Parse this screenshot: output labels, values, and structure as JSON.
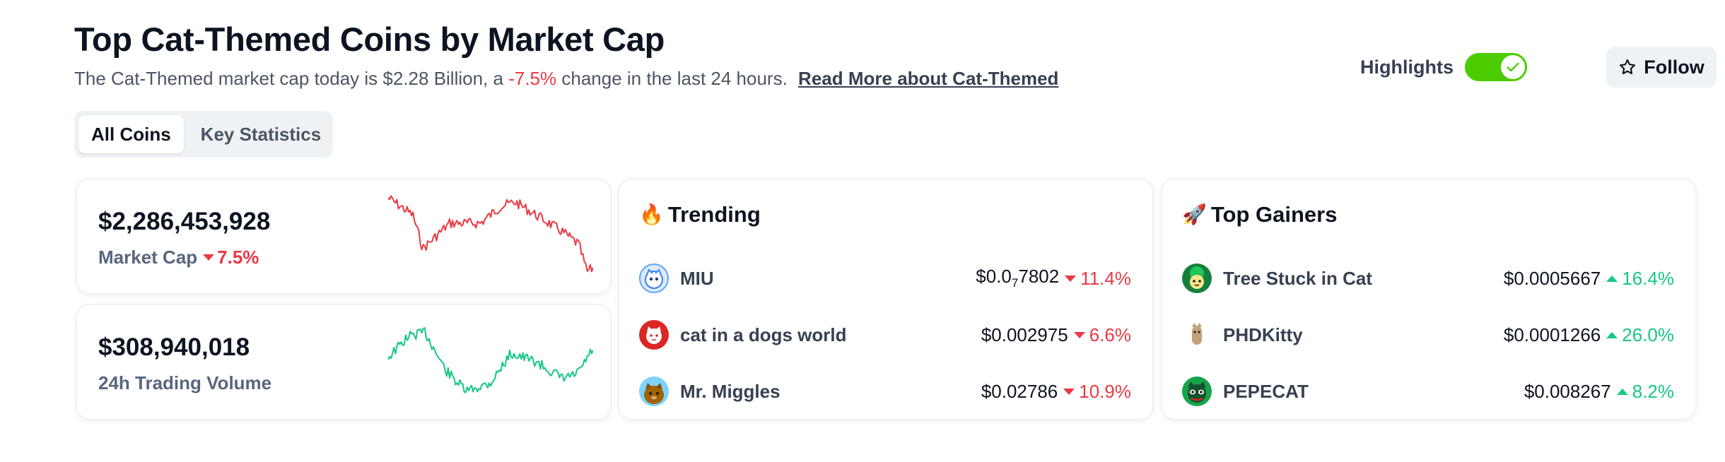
{
  "header": {
    "title": "Top Cat-Themed Coins by Market Cap",
    "subtitle_prefix": "The Cat-Themed market cap today is $2.28 Billion, a",
    "subtitle_change": "-7.5%",
    "subtitle_suffix": "change in the last 24 hours.",
    "read_more": "Read More about Cat-Themed"
  },
  "controls": {
    "highlights_label": "Highlights",
    "highlights_on": true,
    "follow_label": "Follow"
  },
  "tabs": [
    {
      "label": "All Coins",
      "active": true
    },
    {
      "label": "Key Statistics",
      "active": false
    }
  ],
  "market_cap": {
    "value": "$2,286,453,928",
    "label": "Market Cap",
    "change": "7.5%",
    "direction": "down",
    "color": "#ea3943"
  },
  "volume": {
    "value": "$308,940,018",
    "label": "24h Trading Volume",
    "color": "#16c784"
  },
  "trending": {
    "title": "Trending",
    "icon": "fire-icon",
    "items": [
      {
        "name": "MIU",
        "price_main": "$0.0",
        "price_sub": "7",
        "price_rest": "7802",
        "change": "11.4%",
        "direction": "down",
        "icon": "miu-cat-icon"
      },
      {
        "name": "cat in a dogs world",
        "price_main": "$0.002975",
        "price_sub": "",
        "price_rest": "",
        "change": "6.6%",
        "direction": "down",
        "icon": "mew-cat-icon"
      },
      {
        "name": "Mr. Miggles",
        "price_main": "$0.02786",
        "price_sub": "",
        "price_rest": "",
        "change": "10.9%",
        "direction": "down",
        "icon": "miggles-cat-icon"
      }
    ]
  },
  "gainers": {
    "title": "Top Gainers",
    "icon": "rocket-icon",
    "items": [
      {
        "name": "Tree Stuck in Cat",
        "price": "$0.0005667",
        "change": "16.4%",
        "direction": "up",
        "icon": "tree-cat-icon"
      },
      {
        "name": "PHDKitty",
        "price": "$0.0001266",
        "change": "26.0%",
        "direction": "up",
        "icon": "phd-kitty-icon"
      },
      {
        "name": "PEPECAT",
        "price": "$0.008267",
        "change": "8.2%",
        "direction": "up",
        "icon": "pepecat-icon"
      }
    ]
  }
}
